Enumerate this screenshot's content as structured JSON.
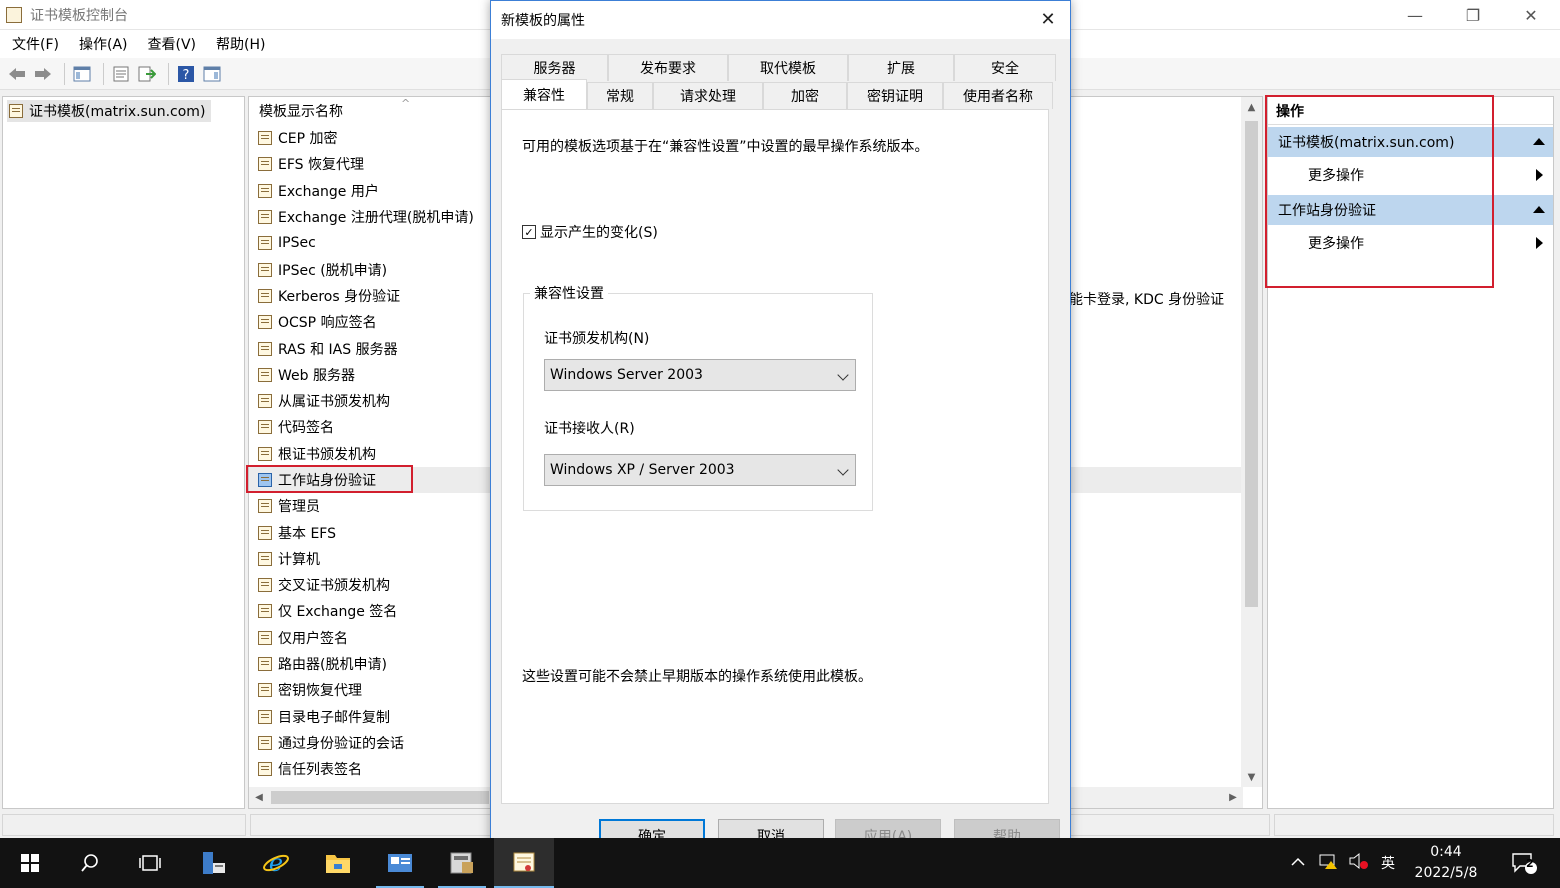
{
  "window": {
    "title": "证书模板控制台",
    "minimize": "—",
    "maximize": "❐",
    "close": "✕"
  },
  "menu": [
    "文件(F)",
    "操作(A)",
    "查看(V)",
    "帮助(H)"
  ],
  "tree": {
    "root": "证书模板(matrix.sun.com)"
  },
  "list": {
    "column_header": "模板显示名称",
    "items": [
      "CEP 加密",
      "EFS 恢复代理",
      "Exchange 用户",
      "Exchange 注册代理(脱机申请)",
      "IPSec",
      "IPSec (脱机申请)",
      "Kerberos 身份验证",
      "OCSP 响应签名",
      "RAS 和 IAS 服务器",
      "Web 服务器",
      "从属证书颁发机构",
      "代码签名",
      "根证书颁发机构",
      "工作站身份验证",
      "管理员",
      "基本 EFS",
      "计算机",
      "交叉证书颁发机构",
      "仅 Exchange 签名",
      "仅用户签名",
      "路由器(脱机申请)",
      "密钥恢复代理",
      "目录电子邮件复制",
      "通过身份验证的会话",
      "信任列表签名"
    ],
    "selected_index": 13,
    "partial_description": "能卡登录, KDC 身份验证"
  },
  "actions": {
    "title": "操作",
    "groups": [
      {
        "label": "证书模板(matrix.sun.com)",
        "item": "更多操作"
      },
      {
        "label": "工作站身份验证",
        "item": "更多操作"
      }
    ]
  },
  "dialog": {
    "title": "新模板的属性",
    "close": "✕",
    "tabs_row1": [
      "服务器",
      "发布要求",
      "取代模板",
      "扩展",
      "安全"
    ],
    "tabs_row2": [
      "兼容性",
      "常规",
      "请求处理",
      "加密",
      "密钥证明",
      "使用者名称"
    ],
    "active_tab": "兼容性",
    "intro": "可用的模板选项基于在“兼容性设置”中设置的最早操作系统版本。",
    "show_changes_label": "显示产生的变化(S)",
    "show_changes_checked": true,
    "group_label": "兼容性设置",
    "ca_label": "证书颁发机构(N)",
    "ca_value": "Windows Server 2003",
    "recipient_label": "证书接收人(R)",
    "recipient_value": "Windows XP / Server 2003",
    "footer_note": "这些设置可能不会禁止早期版本的操作系统使用此模板。",
    "buttons": {
      "ok": "确定",
      "cancel": "取消",
      "apply": "应用(A)",
      "help": "帮助"
    }
  },
  "taskbar": {
    "ime": "英",
    "time": "0:44",
    "date": "2022/5/8",
    "notifications": "2"
  },
  "colors": {
    "highlight_red": "#d21f2e",
    "action_group_bg": "#bdd6ee",
    "accent_blue": "#0078d7"
  }
}
